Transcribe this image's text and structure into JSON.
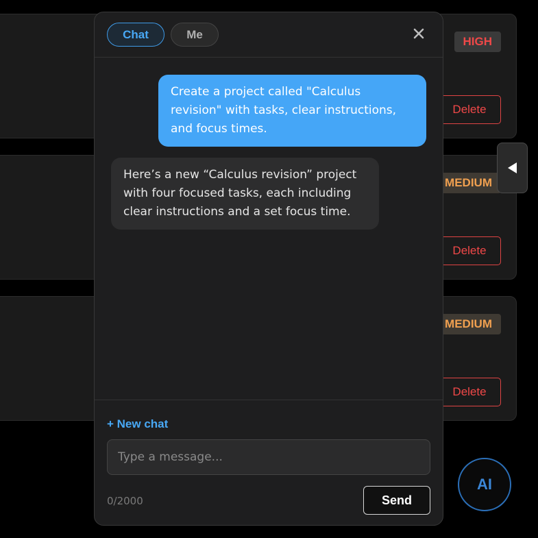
{
  "tasks": [
    {
      "priority": "HIGH",
      "delete_label": "Delete"
    },
    {
      "priority": "MEDIUM",
      "delete_label": "Delete"
    },
    {
      "priority": "MEDIUM",
      "delete_label": "Delete"
    }
  ],
  "chat": {
    "tabs": [
      {
        "label": "Chat",
        "active": true
      },
      {
        "label": "Me",
        "active": false
      }
    ],
    "messages": [
      {
        "role": "user",
        "text": "Create a project called \"Calculus revision\" with tasks, clear instructions, and focus times."
      },
      {
        "role": "assistant",
        "text": "Here’s a new “Calculus revision” project with four focused tasks, each including clear instructions and a set focus time."
      }
    ],
    "new_chat_label": "+ New chat",
    "input": {
      "placeholder": "Type a message...",
      "value": ""
    },
    "char_count": "0/2000",
    "send_label": "Send"
  },
  "fab_label": "AI",
  "icons": {
    "close": "close-icon",
    "toggle": "triangle-left-icon"
  },
  "colors": {
    "accent": "#45a6f7",
    "danger": "#f04848",
    "warning": "#f0a050"
  }
}
